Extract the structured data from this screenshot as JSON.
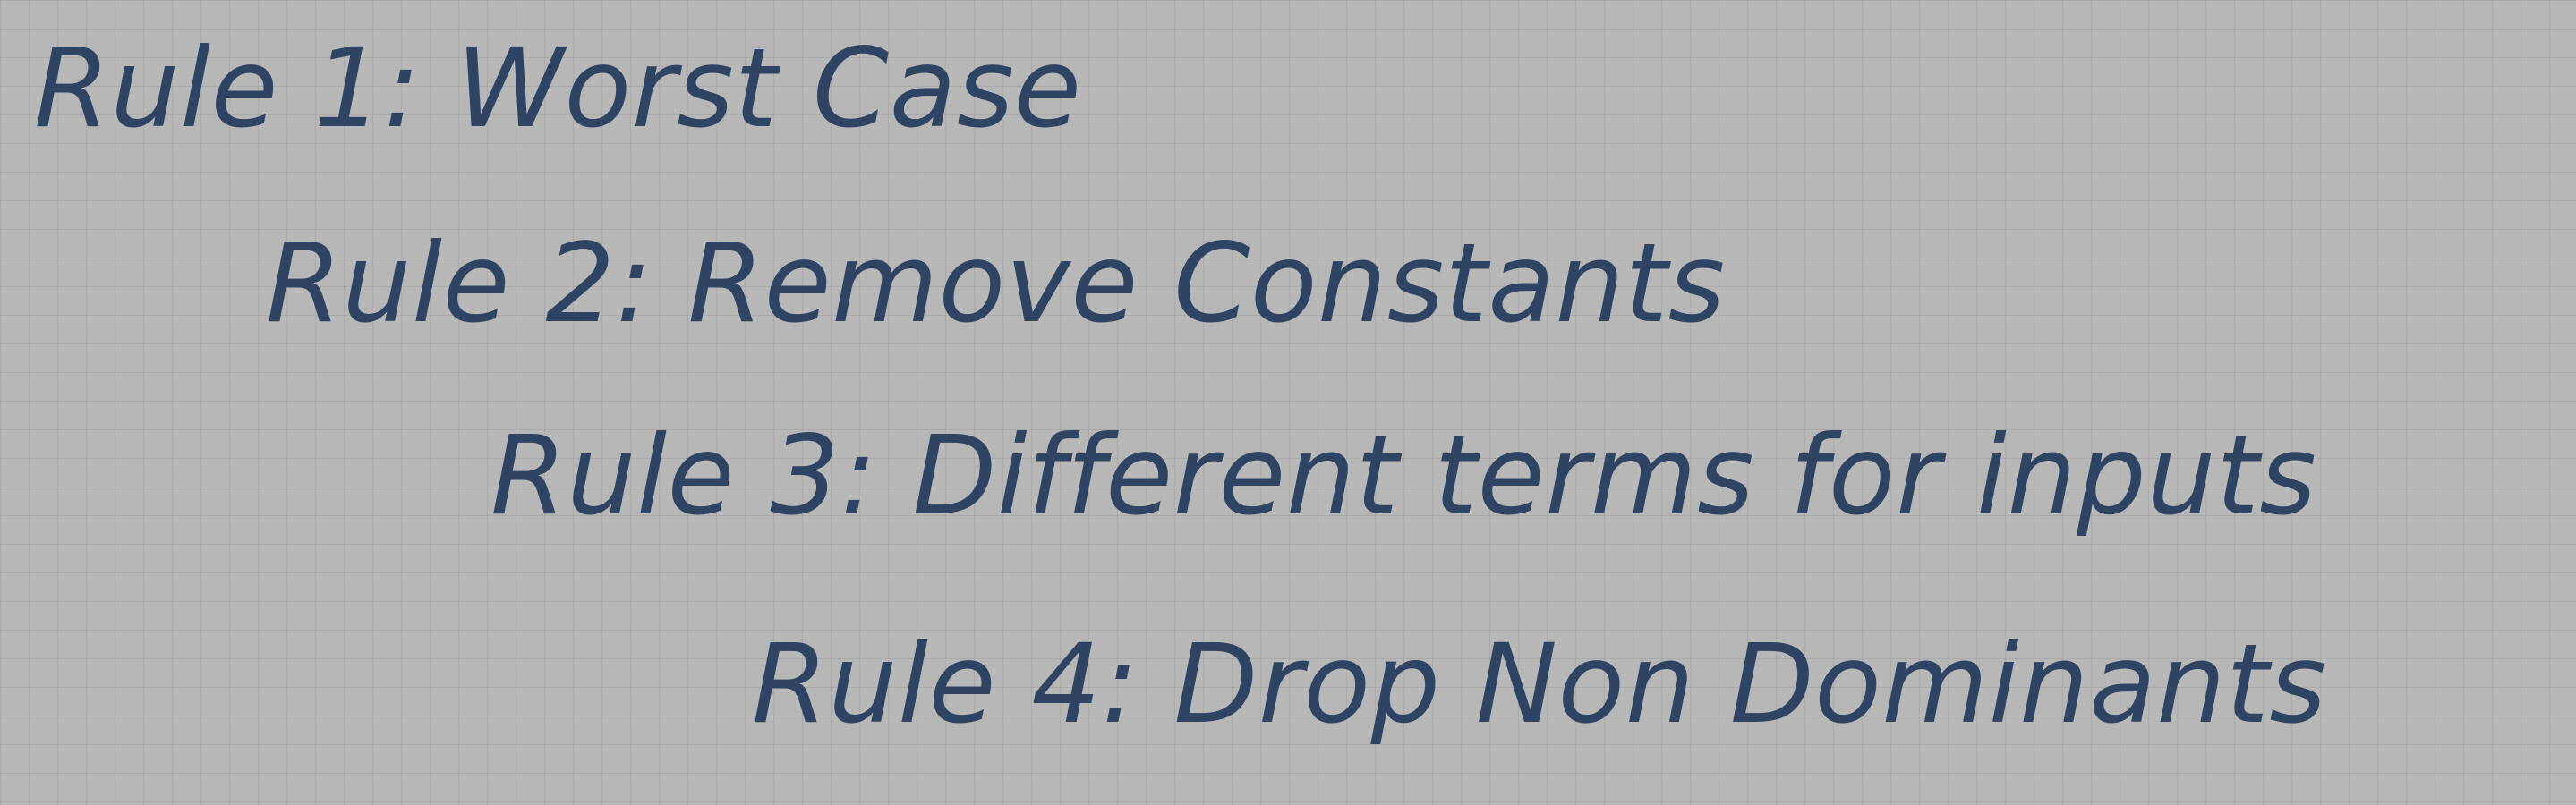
{
  "rules": [
    {
      "label": "Rule 1: Worst Case"
    },
    {
      "label": "Rule 2: Remove Constants"
    },
    {
      "label": "Rule 3: Different terms for inputs"
    },
    {
      "label": "Rule 4: Drop Non Dominants"
    }
  ],
  "colors": {
    "text": "#2f4463",
    "background": "#b8b8b8"
  }
}
